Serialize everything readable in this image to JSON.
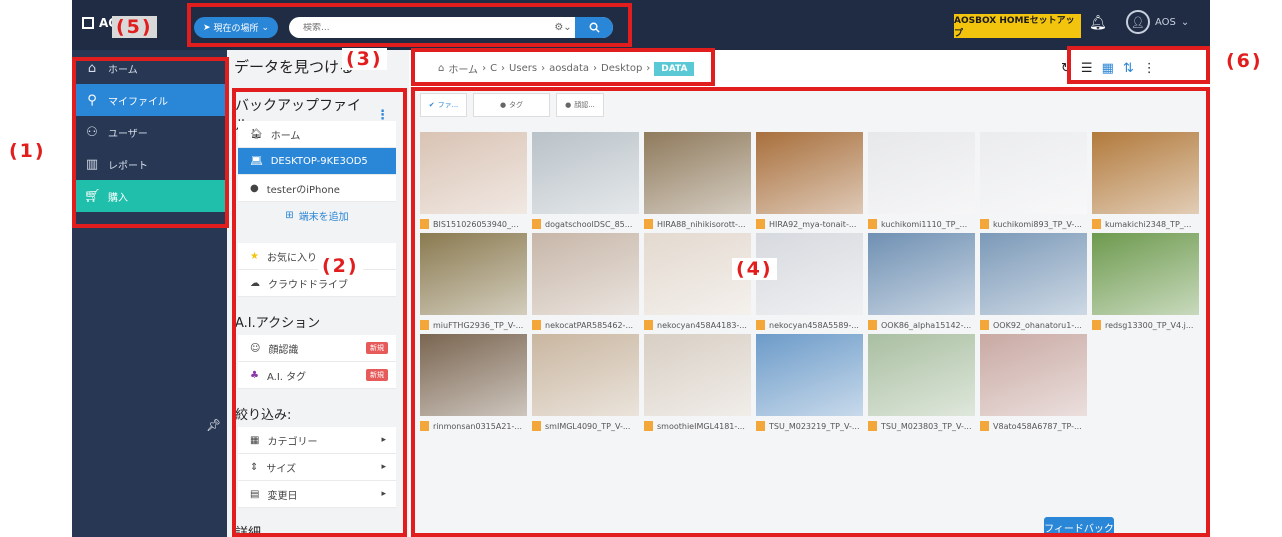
{
  "topbar": {
    "logo_text": "AOS",
    "location_button": "現在の場所",
    "search_placeholder": "検索...",
    "setup_button": "AOSBOX HOMEセットアップ",
    "user_name": "AOS"
  },
  "nav": {
    "items": [
      {
        "label": "ホーム",
        "icon": "home-icon",
        "state": "normal"
      },
      {
        "label": "マイファイル",
        "icon": "search-icon",
        "state": "active"
      },
      {
        "label": "ユーザー",
        "icon": "users-icon",
        "state": "normal"
      },
      {
        "label": "レポート",
        "icon": "chart-icon",
        "state": "normal"
      },
      {
        "label": "購入",
        "icon": "cart-icon",
        "state": "buy"
      }
    ]
  },
  "panel": {
    "find_title": "データを見つける",
    "backup_title": "バックアップファイル",
    "backup_items": [
      {
        "label": "ホーム",
        "icon": "home-icon"
      },
      {
        "label": "DESKTOP-9KE3OD5",
        "icon": "laptop-icon"
      },
      {
        "label": "testerのiPhone",
        "icon": "apple-icon"
      }
    ],
    "add_device": "端末を追加",
    "favorites": "お気に入り",
    "cloud": "クラウドドライブ",
    "ai_title": "A.I.アクション",
    "ai_items": [
      {
        "label": "顔認識",
        "badge": "新規"
      },
      {
        "label": "A.I. タグ",
        "badge": "新規"
      }
    ],
    "filter_title": "絞り込み:",
    "filter_items": [
      {
        "label": "カテゴリー"
      },
      {
        "label": "サイズ"
      },
      {
        "label": "変更日"
      }
    ],
    "details_title": "詳細"
  },
  "breadcrumb": {
    "items": [
      "ホーム",
      "C",
      "Users",
      "aosdata",
      "Desktop"
    ],
    "current": "DATA"
  },
  "content": {
    "filters": [
      "ファ...",
      "タグ",
      "顔認..."
    ],
    "files": [
      {
        "name": "BIS151026053940_...",
        "color": "#d9c3b4"
      },
      {
        "name": "dogatschoolDSC_85...",
        "color": "#b9c2c8"
      },
      {
        "name": "HIRA88_nihikisorott-...",
        "color": "#8f7a5c"
      },
      {
        "name": "HIRA92_mya-tonait-...",
        "color": "#a86f3c"
      },
      {
        "name": "kuchikomi1110_TP_...",
        "color": "#e7e8ea"
      },
      {
        "name": "kuchikomi893_TP_V-...",
        "color": "#ebecee"
      },
      {
        "name": "kumakichi2348_TP_...",
        "color": "#b27a3c"
      },
      {
        "name": "miuFTHG2936_TP_V-...",
        "color": "#8a7a50"
      },
      {
        "name": "nekocatPAR585462-...",
        "color": "#c7b6a8"
      },
      {
        "name": "nekocyan458A4183-...",
        "color": "#e3d9cf"
      },
      {
        "name": "nekocyan458A5589-...",
        "color": "#d6d9de"
      },
      {
        "name": "OOK86_alpha15142-...",
        "color": "#6f90b3"
      },
      {
        "name": "OOK92_ohanatoru1-...",
        "color": "#7b99b8"
      },
      {
        "name": "redsg13300_TP_V4.j...",
        "color": "#6d9a4e"
      },
      {
        "name": "rinmonsan0315A21-...",
        "color": "#7a6550"
      },
      {
        "name": "smIMGL4090_TP_V-...",
        "color": "#c9b6a0"
      },
      {
        "name": "smoothieIMGL4181-...",
        "color": "#d8cfc4"
      },
      {
        "name": "TSU_M023219_TP_V-...",
        "color": "#6c9bc9"
      },
      {
        "name": "TSU_M023803_TP_V-...",
        "color": "#a9bfa1"
      },
      {
        "name": "V8ato458A6787_TP-...",
        "color": "#c9a9a3"
      }
    ],
    "feedback": "フィードバック"
  },
  "annotations": [
    "(1)",
    "(2)",
    "(3)",
    "(4)",
    "(5)",
    "(6)"
  ],
  "colors": {
    "topbar": "#1f2c44",
    "nav": "#273754",
    "accent": "#2a86d6",
    "buy": "#1fbfab",
    "annotation": "#e11d1d"
  }
}
